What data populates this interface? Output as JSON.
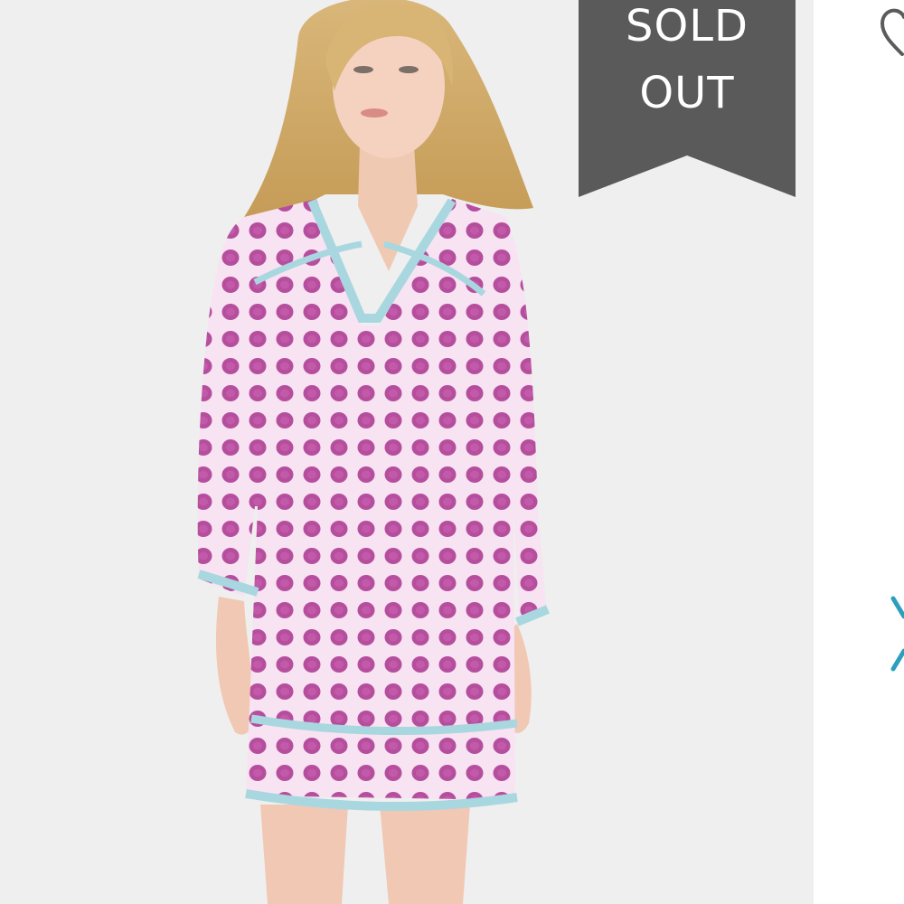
{
  "badge": {
    "text": "SOLD\nOUT",
    "color": "#5a5a5a"
  },
  "colors": {
    "photo_background": "#efefef",
    "dress_pink": "#f3d6ec",
    "dress_dot": "#b64e9e",
    "trim_blue": "#a9d7df",
    "accent_icon": "#2b9fbd"
  },
  "icons": {
    "favorite": "heart-icon",
    "next": "chevron-right-icon"
  }
}
